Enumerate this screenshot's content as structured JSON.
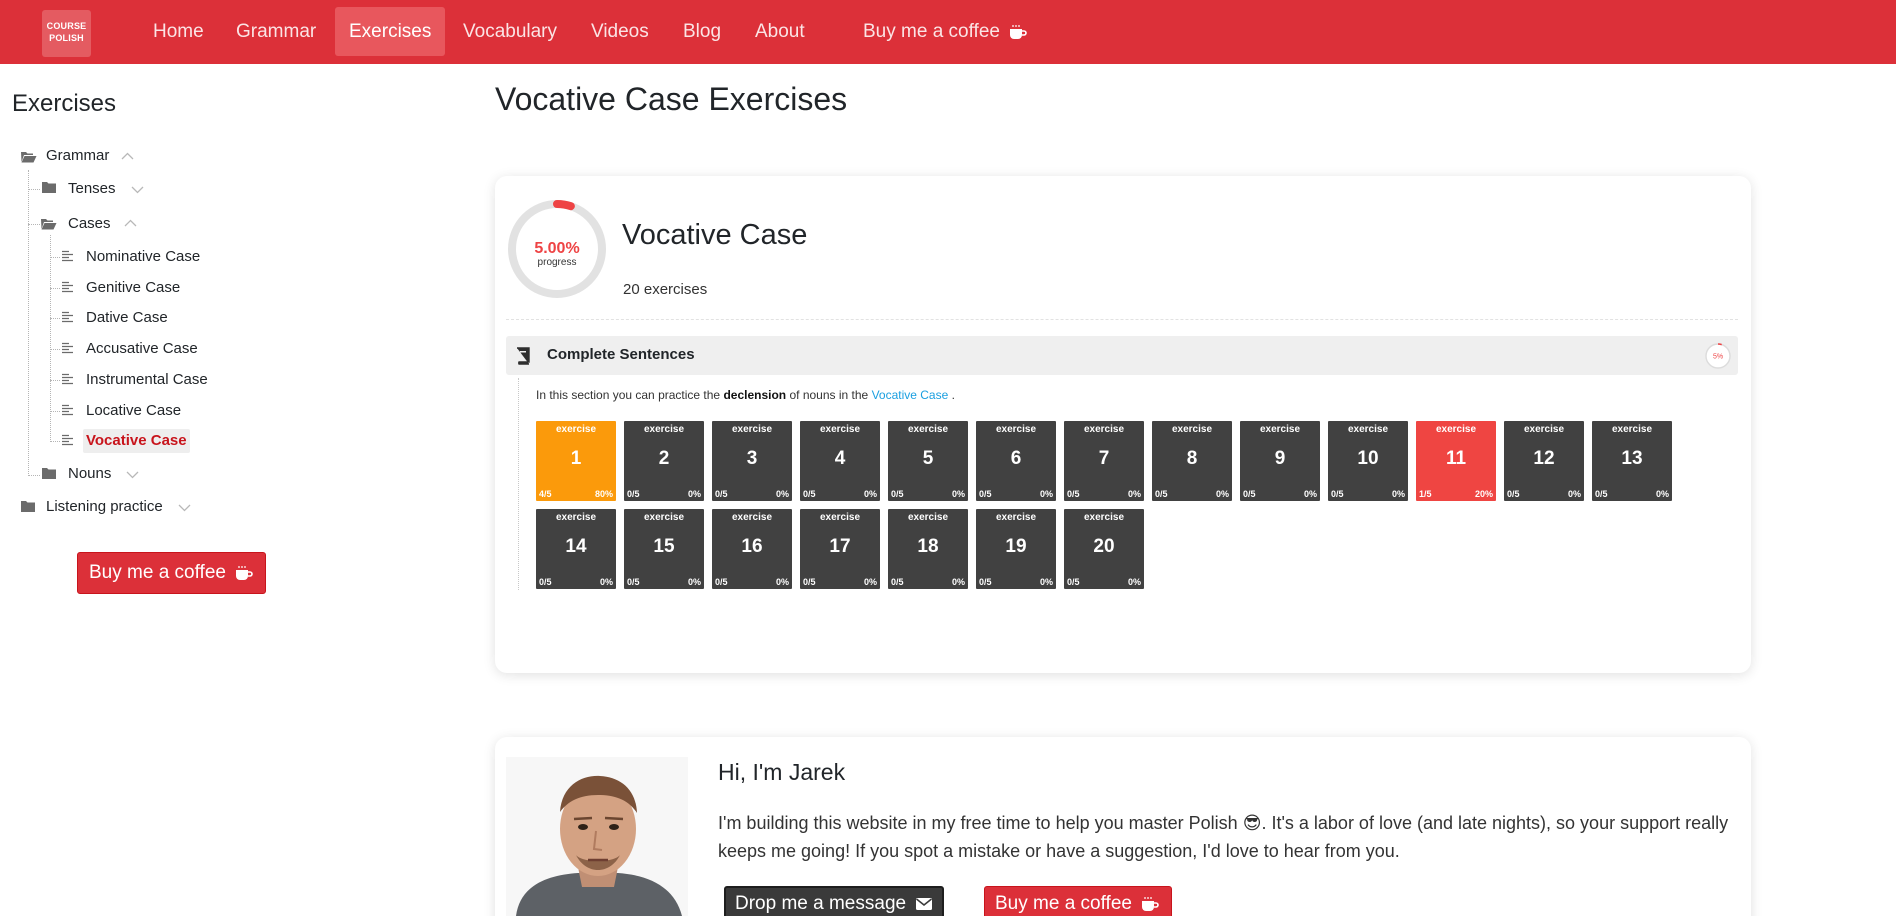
{
  "brand": {
    "logo_text_1": "COURSE",
    "logo_text_2": "POLISH"
  },
  "nav": {
    "items": [
      {
        "label": "Home"
      },
      {
        "label": "Grammar"
      },
      {
        "label": "Exercises"
      },
      {
        "label": "Vocabulary"
      },
      {
        "label": "Videos"
      },
      {
        "label": "Blog"
      },
      {
        "label": "About"
      },
      {
        "label": "Buy me a coffee"
      }
    ],
    "active": "Exercises"
  },
  "sidebar": {
    "title": "Exercises",
    "tree": {
      "grammar": "Grammar",
      "tenses": "Tenses",
      "cases": "Cases",
      "case_items": [
        "Nominative Case",
        "Genitive Case",
        "Dative Case",
        "Accusative Case",
        "Instrumental Case",
        "Locative Case",
        "Vocative Case"
      ],
      "selected": "Vocative Case",
      "nouns": "Nouns",
      "listening": "Listening practice"
    },
    "coffee_button": "Buy me a coffee"
  },
  "main": {
    "page_title": "Vocative Case Exercises",
    "card": {
      "title": "Vocative Case",
      "subtitle": "20 exercises",
      "progress_text": "5.00%",
      "progress_label": "progress",
      "progress_fraction": 0.05,
      "section": {
        "title": "Complete Sentences",
        "mini_progress_text": "5%",
        "desc_before": "In this section you can practice the",
        "desc_bold": "declension",
        "desc_middle": "of nouns in the",
        "desc_link": "Vocative Case",
        "desc_after": ".",
        "tile_label": "exercise",
        "exercises": [
          {
            "num": "1",
            "score": "4/5",
            "pct": "80%",
            "state": "done"
          },
          {
            "num": "2",
            "score": "0/5",
            "pct": "0%",
            "state": "none"
          },
          {
            "num": "3",
            "score": "0/5",
            "pct": "0%",
            "state": "none"
          },
          {
            "num": "4",
            "score": "0/5",
            "pct": "0%",
            "state": "none"
          },
          {
            "num": "5",
            "score": "0/5",
            "pct": "0%",
            "state": "none"
          },
          {
            "num": "6",
            "score": "0/5",
            "pct": "0%",
            "state": "none"
          },
          {
            "num": "7",
            "score": "0/5",
            "pct": "0%",
            "state": "none"
          },
          {
            "num": "8",
            "score": "0/5",
            "pct": "0%",
            "state": "none"
          },
          {
            "num": "9",
            "score": "0/5",
            "pct": "0%",
            "state": "none"
          },
          {
            "num": "10",
            "score": "0/5",
            "pct": "0%",
            "state": "none"
          },
          {
            "num": "11",
            "score": "1/5",
            "pct": "20%",
            "state": "partial"
          },
          {
            "num": "12",
            "score": "0/5",
            "pct": "0%",
            "state": "none"
          },
          {
            "num": "13",
            "score": "0/5",
            "pct": "0%",
            "state": "none"
          },
          {
            "num": "14",
            "score": "0/5",
            "pct": "0%",
            "state": "none"
          },
          {
            "num": "15",
            "score": "0/5",
            "pct": "0%",
            "state": "none"
          },
          {
            "num": "16",
            "score": "0/5",
            "pct": "0%",
            "state": "none"
          },
          {
            "num": "17",
            "score": "0/5",
            "pct": "0%",
            "state": "none"
          },
          {
            "num": "18",
            "score": "0/5",
            "pct": "0%",
            "state": "none"
          },
          {
            "num": "19",
            "score": "0/5",
            "pct": "0%",
            "state": "none"
          },
          {
            "num": "20",
            "score": "0/5",
            "pct": "0%",
            "state": "none"
          }
        ]
      }
    },
    "about": {
      "title": "Hi, I'm Jarek",
      "text_1": "I'm building this website in my free time to help you master Polish",
      "emoji": "😎",
      "text_2": ". It's a labor of love (and late nights), so your support really keeps me going! If you spot a mistake or have a suggestion, I'd love to hear from you.",
      "message_button": "Drop me a message",
      "coffee_button": "Buy me a coffee"
    }
  },
  "colors": {
    "brand_red": "#dc3039",
    "done_orange": "#fb9a0b",
    "partial_red": "#ef4542",
    "tile_dark": "#414141",
    "link_blue": "#1a9fe0"
  },
  "icons": [
    "folder-open-icon",
    "folder-icon",
    "chevron-up-icon",
    "chevron-down-icon",
    "list-icon",
    "coffee-cup-icon",
    "book-icon",
    "envelope-icon"
  ]
}
